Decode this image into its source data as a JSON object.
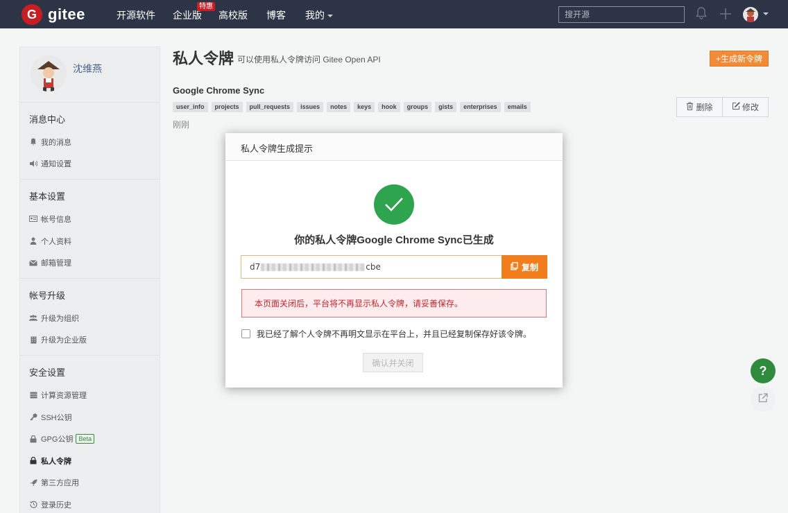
{
  "topnav": {
    "logo_text": "gitee",
    "logo_letter": "G",
    "items": [
      {
        "label": "开源软件"
      },
      {
        "label": "企业版"
      },
      {
        "label": "高校版"
      },
      {
        "label": "博客"
      },
      {
        "label": "我的"
      }
    ],
    "badge": "特惠",
    "search_placeholder": "搜开源"
  },
  "sidebar": {
    "username": "沈维燕",
    "sections": [
      {
        "heading": "消息中心",
        "items": [
          {
            "label": "我的消息",
            "icon": "bell-icon"
          },
          {
            "label": "通知设置",
            "icon": "speaker-icon"
          }
        ]
      },
      {
        "heading": "基本设置",
        "items": [
          {
            "label": "帐号信息",
            "icon": "id-card-icon"
          },
          {
            "label": "个人资料",
            "icon": "user-icon"
          },
          {
            "label": "邮箱管理",
            "icon": "envelope-icon"
          }
        ]
      },
      {
        "heading": "帐号升级",
        "items": [
          {
            "label": "升级为组织",
            "icon": "group-icon"
          },
          {
            "label": "升级为企业版",
            "icon": "building-icon"
          }
        ]
      },
      {
        "heading": "安全设置",
        "items": [
          {
            "label": "计算资源管理",
            "icon": "server-icon"
          },
          {
            "label": "SSH公钥",
            "icon": "key-icon"
          },
          {
            "label": "GPG公钥",
            "icon": "lock-icon",
            "badge": "Beta"
          },
          {
            "label": "私人令牌",
            "icon": "lock-icon",
            "active": true
          },
          {
            "label": "第三方应用",
            "icon": "rocket-icon"
          },
          {
            "label": "登录历史",
            "icon": "history-icon"
          }
        ]
      }
    ]
  },
  "main": {
    "title": "私人令牌",
    "subtitle": "可以使用私人令牌访问 Gitee Open API",
    "generate_button": "+生成新令牌",
    "token": {
      "name": "Google Chrome Sync",
      "scopes": [
        "user_info",
        "projects",
        "pull_requests",
        "issues",
        "notes",
        "keys",
        "hook",
        "groups",
        "gists",
        "enterprises",
        "emails"
      ],
      "time": "刚刚"
    },
    "delete_label": "删除",
    "edit_label": "修改"
  },
  "modal": {
    "header": "私人令牌生成提示",
    "title": "你的私人令牌Google Chrome Sync已生成",
    "token_prefix": "d7",
    "token_suffix": "cbe",
    "copy_label": "复制",
    "warning": "本页面关闭后，平台将不再显示私人令牌，请妥善保存。",
    "checkbox_label": "我已经了解个人令牌不再明文显示在平台上，并且已经复制保存好该令牌。",
    "confirm_label": "确认并关闭"
  },
  "floating": {
    "help": "?"
  },
  "colors": {
    "nav_bg": "#2d3445",
    "brand": "#c71d23",
    "orange": "#f27d1c",
    "success": "#2ea44f"
  }
}
